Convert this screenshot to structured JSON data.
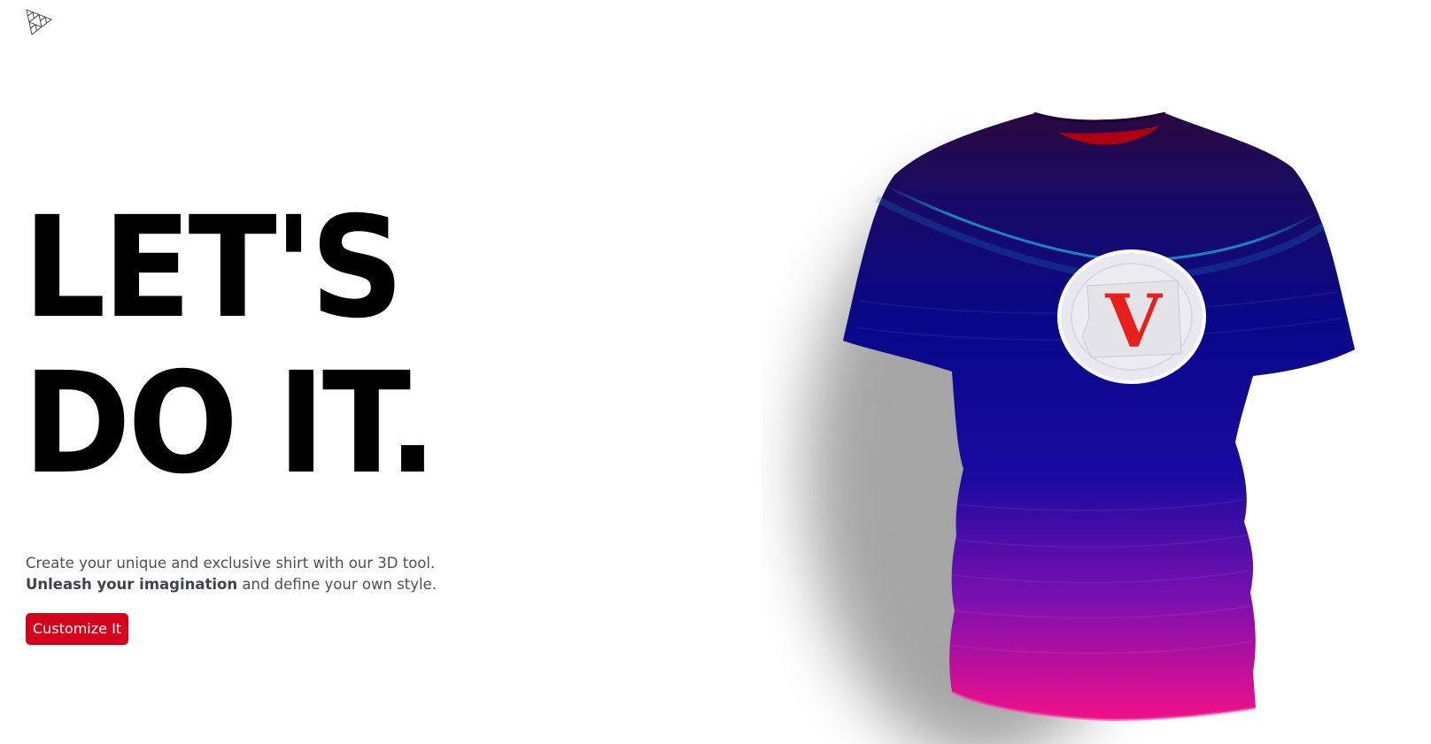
{
  "header": {
    "logo_icon": "threejs-triangle-logo-icon"
  },
  "hero": {
    "headline_line1": "LET'S",
    "headline_line2": "DO IT.",
    "tagline_line1": "Create your unique and exclusive shirt with our 3D tool.",
    "tagline_bold": "Unleash your imagination",
    "tagline_rest": " and define your own style.",
    "cta_label": "Customize It"
  },
  "shirt": {
    "logo_letter": "V",
    "colors": {
      "top": "#2a0a4a",
      "middle": "#0a0a8f",
      "bottom": "#e0109a",
      "accent_glow": "#1aa0d8",
      "collar": "#b00010",
      "logo_red": "#e8201c"
    }
  },
  "colors": {
    "cta_background": "#d6001c",
    "text_dark": "#000000",
    "text_muted": "#4b4f5c"
  }
}
